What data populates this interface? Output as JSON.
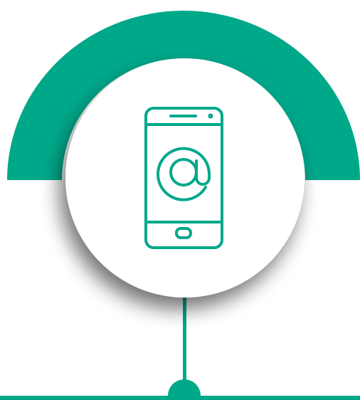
{
  "colors": {
    "accent": "#00a88a",
    "background": "#ffffff",
    "circle_fill": "#ffffff",
    "shadow": "#000000"
  },
  "icon": {
    "name": "smartphone-email-icon",
    "symbol": "@"
  }
}
